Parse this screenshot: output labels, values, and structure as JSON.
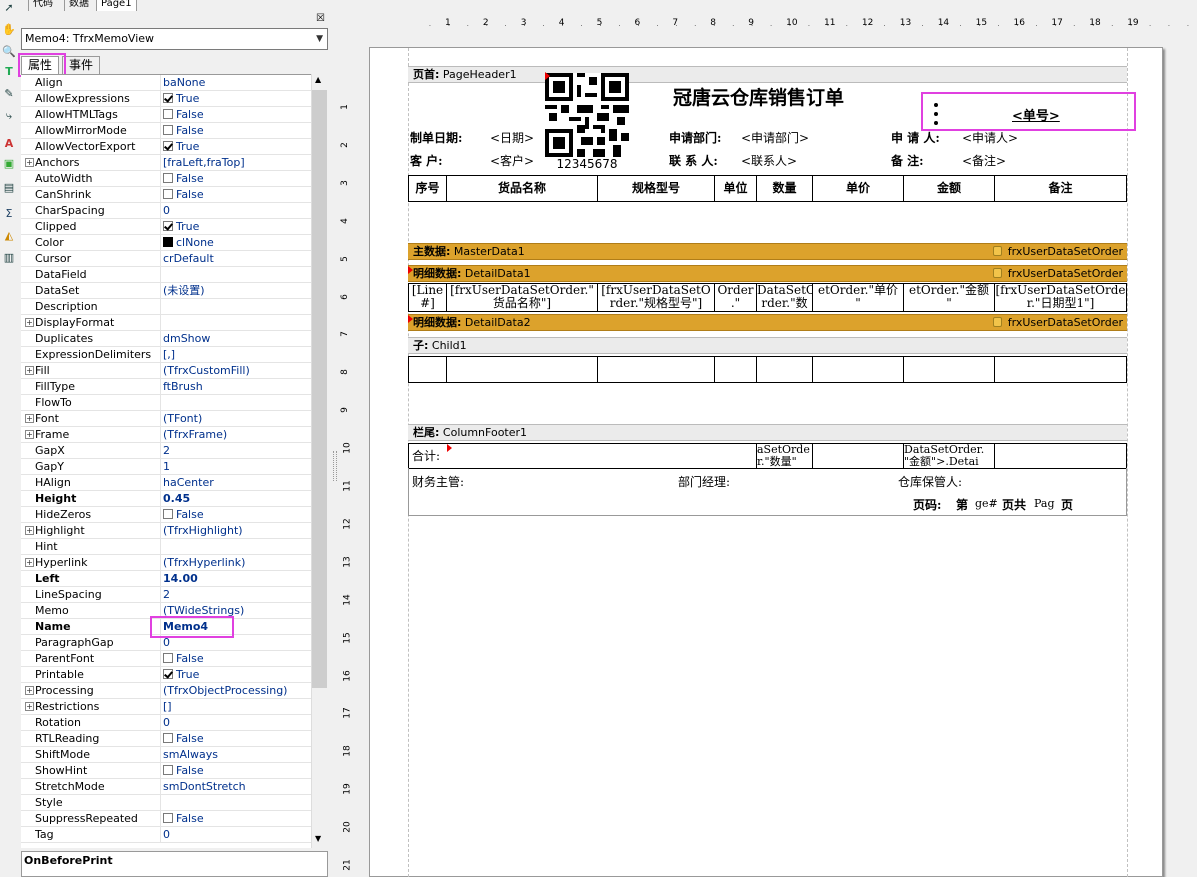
{
  "tabs": [
    "代码",
    "数据",
    "Page1"
  ],
  "inspector": {
    "selected_object": "Memo4: TfrxMemoView",
    "tab_properties": "属性",
    "tab_events": "事件",
    "event_header": "OnBeforePrint",
    "properties": [
      {
        "name": "Align",
        "value": "baNone"
      },
      {
        "name": "AllowExpressions",
        "value": "True",
        "check": true
      },
      {
        "name": "AllowHTMLTags",
        "value": "False",
        "check": false
      },
      {
        "name": "AllowMirrorMode",
        "value": "False",
        "check": false
      },
      {
        "name": "AllowVectorExport",
        "value": "True",
        "check": true
      },
      {
        "name": "Anchors",
        "value": "[fraLeft,fraTop]",
        "expand": true
      },
      {
        "name": "AutoWidth",
        "value": "False",
        "check": false
      },
      {
        "name": "CanShrink",
        "value": "False",
        "check": false
      },
      {
        "name": "CharSpacing",
        "value": "0"
      },
      {
        "name": "Clipped",
        "value": "True",
        "check": true
      },
      {
        "name": "Color",
        "value": "clNone",
        "swatch": true
      },
      {
        "name": "Cursor",
        "value": "crDefault"
      },
      {
        "name": "DataField",
        "value": ""
      },
      {
        "name": "DataSet",
        "value": "(未设置)"
      },
      {
        "name": "Description",
        "value": ""
      },
      {
        "name": "DisplayFormat",
        "value": "",
        "expand": true
      },
      {
        "name": "Duplicates",
        "value": "dmShow"
      },
      {
        "name": "ExpressionDelimiters",
        "value": "[,]"
      },
      {
        "name": "Fill",
        "value": "(TfrxCustomFill)",
        "expand": true
      },
      {
        "name": "FillType",
        "value": "ftBrush"
      },
      {
        "name": "FlowTo",
        "value": ""
      },
      {
        "name": "Font",
        "value": "(TFont)",
        "expand": true
      },
      {
        "name": "Frame",
        "value": "(TfrxFrame)",
        "expand": true
      },
      {
        "name": "GapX",
        "value": "2"
      },
      {
        "name": "GapY",
        "value": "1"
      },
      {
        "name": "HAlign",
        "value": "haCenter"
      },
      {
        "name": "Height",
        "value": "0.45",
        "bold": true
      },
      {
        "name": "HideZeros",
        "value": "False",
        "check": false
      },
      {
        "name": "Highlight",
        "value": "(TfrxHighlight)",
        "expand": true
      },
      {
        "name": "Hint",
        "value": ""
      },
      {
        "name": "Hyperlink",
        "value": "(TfrxHyperlink)",
        "expand": true
      },
      {
        "name": "Left",
        "value": "14.00",
        "bold": true
      },
      {
        "name": "LineSpacing",
        "value": "2"
      },
      {
        "name": "Memo",
        "value": "(TWideStrings)"
      },
      {
        "name": "Name",
        "value": "Memo4",
        "bold": true
      },
      {
        "name": "ParagraphGap",
        "value": "0"
      },
      {
        "name": "ParentFont",
        "value": "False",
        "check": false
      },
      {
        "name": "Printable",
        "value": "True",
        "check": true
      },
      {
        "name": "Processing",
        "value": "(TfrxObjectProcessing)",
        "expand": true
      },
      {
        "name": "Restrictions",
        "value": "[]",
        "expand": true
      },
      {
        "name": "Rotation",
        "value": "0"
      },
      {
        "name": "RTLReading",
        "value": "False",
        "check": false
      },
      {
        "name": "ShiftMode",
        "value": "smAlways"
      },
      {
        "name": "ShowHint",
        "value": "False",
        "check": false
      },
      {
        "name": "StretchMode",
        "value": "smDontStretch"
      },
      {
        "name": "Style",
        "value": ""
      },
      {
        "name": "SuppressRepeated",
        "value": "False",
        "check": false
      },
      {
        "name": "Tag",
        "value": "0"
      }
    ]
  },
  "ruler": {
    "h": [
      "1",
      "2",
      "3",
      "4",
      "5",
      "6",
      "7",
      "8",
      "9",
      "10",
      "11",
      "12",
      "13",
      "14",
      "15",
      "16",
      "17",
      "18",
      "19"
    ],
    "v": [
      "1",
      "2",
      "3",
      "4",
      "5",
      "6",
      "7",
      "8",
      "9",
      "10",
      "11",
      "12",
      "13",
      "14",
      "15",
      "16",
      "17",
      "18",
      "19",
      "20",
      "21"
    ]
  },
  "report": {
    "page_header_band": "页首:",
    "page_header_name": "PageHeader1",
    "title": "冠唐云仓库销售订单",
    "order_no": "<单号>",
    "barcode_text": "12345678",
    "row1": [
      "制单日期:",
      "<日期>",
      "申请部门:",
      "<申请部门>",
      "申 请 人:",
      "<申请人>"
    ],
    "row2": [
      "客    户:",
      "<客户>",
      "联 系 人:",
      "<联系人>",
      "备    注:",
      "<备注>"
    ],
    "headers": [
      "序号",
      "货品名称",
      "规格型号",
      "单位",
      "数量",
      "单价",
      "金额",
      "备注"
    ],
    "master_band": "主数据:",
    "master_name": "MasterData1",
    "dataset_name": "frxUserDataSetOrder",
    "detail1_band": "明细数据:",
    "detail1_name": "DetailData1",
    "detail_cells": [
      "[Line\n#]",
      "[frxUserDataSetOrder.\"\n货品名称\"]",
      "[frxUserDataSetO\nrder.\"规格型号\"]",
      "Order\n.\"",
      "DataSetO\nrder.\"数",
      "etOrder.\"单价\n\"",
      "etOrder.\"金额\n\"",
      "[frxUserDataSetOrde\nr.\"日期型1\"]"
    ],
    "detail2_band": "明细数据:",
    "detail2_name": "DetailData2",
    "child_band": "子:",
    "child_name": "Child1",
    "footer_band": "栏尾:",
    "footer_name": "ColumnFooter1",
    "footer_total": "合计:",
    "footer_qty": "aSetOrde\nr.\"数量\"",
    "footer_amount": "DataSetOrder.\n\"金额\">.Detai",
    "sign1": "财务主管:",
    "sign2": "部门经理:",
    "sign3": "仓库保管人:",
    "page_no": "页码:",
    "page_parts": [
      "第",
      "ge#",
      "页共",
      "Pag",
      "页"
    ]
  }
}
